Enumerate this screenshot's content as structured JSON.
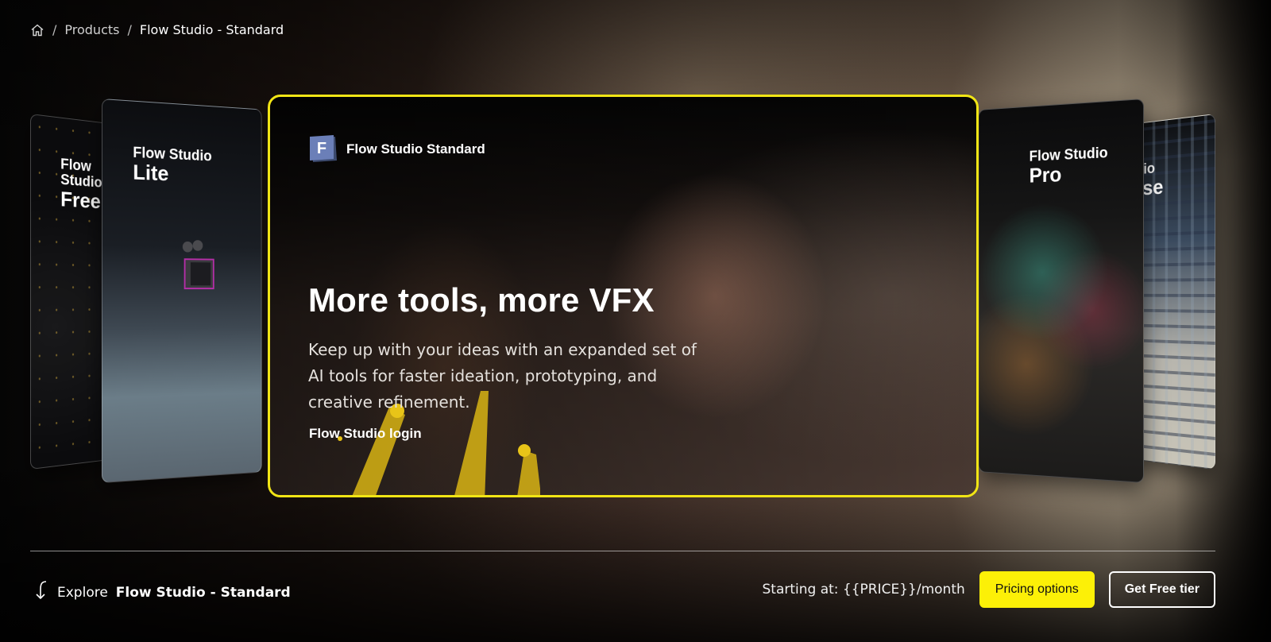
{
  "breadcrumb": {
    "products": "Products",
    "current": "Flow Studio - Standard"
  },
  "cards": {
    "free": {
      "line1": "Flow Studio",
      "line2": "Free"
    },
    "lite": {
      "line1": "Flow Studio",
      "line2": "Lite"
    },
    "pro": {
      "line1": "Flow Studio",
      "line2": "Pro"
    },
    "enterprise": {
      "line1": "Flow Studio",
      "line2": "Enterprise"
    }
  },
  "main_card": {
    "logo_letter": "F",
    "product_name": "Flow Studio Standard",
    "title": "More tools, more VFX",
    "description": "Keep up with your ideas with an expanded set of AI tools for faster ideation, prototyping, and creative refinement.",
    "login_link": "Flow Studio login"
  },
  "footer": {
    "explore_prefix": "Explore",
    "explore_product": "Flow Studio - Standard",
    "price_text": "Starting at: {{PRICE}}/month",
    "pricing_button": "Pricing options",
    "free_tier_button": "Get Free tier"
  },
  "colors": {
    "accent": "#fcf007",
    "card_border": "#f1e515"
  },
  "icons": {
    "home": "home-icon",
    "explore": "arrow-down-curve-icon"
  }
}
